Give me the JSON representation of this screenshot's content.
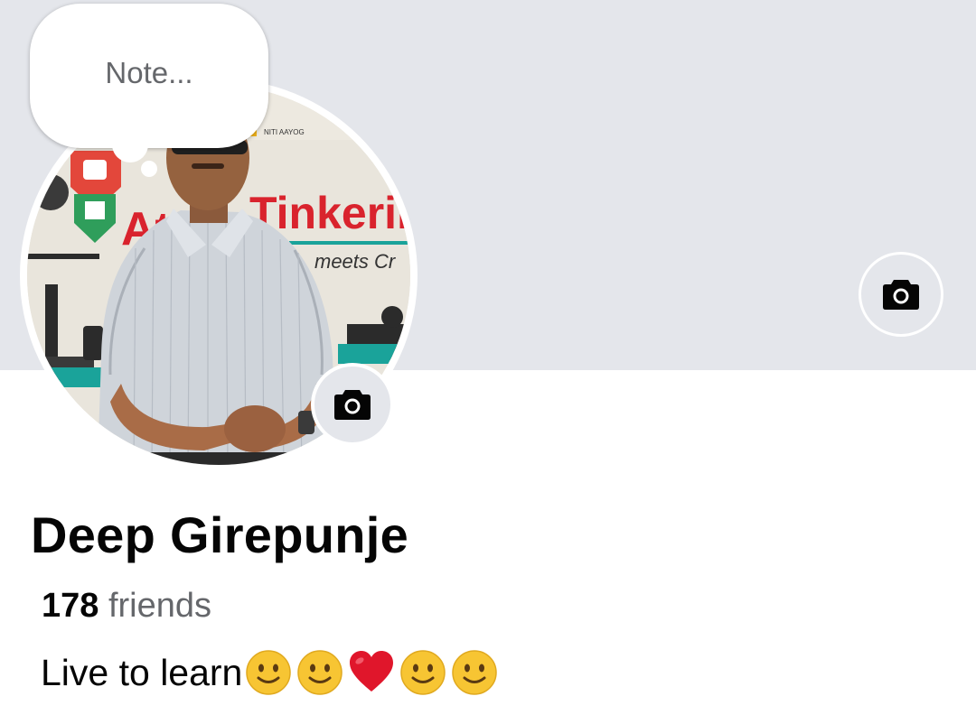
{
  "note": {
    "placeholder": "Note..."
  },
  "profile": {
    "name": "Deep Girepunje",
    "friends_count": "178",
    "friends_label": "friends",
    "bio_text": "Live to learn",
    "bio_emojis": [
      "slightly-smiling-face",
      "slightly-smiling-face",
      "red-heart",
      "slightly-smiling-face",
      "slightly-smiling-face"
    ]
  },
  "photo_background_text": {
    "org": "NITI AAYOG",
    "banner_left": "At",
    "banner_right": "Tinkering",
    "tagline": "meets Cr"
  },
  "icons": {
    "cover_camera": "camera-icon",
    "avatar_camera": "camera-icon"
  },
  "colors": {
    "cover_bg": "#e4e6eb",
    "text_primary": "#050505",
    "text_secondary": "#65676b",
    "banner_red": "#d9232d",
    "banner_teal": "#1aa39a"
  }
}
